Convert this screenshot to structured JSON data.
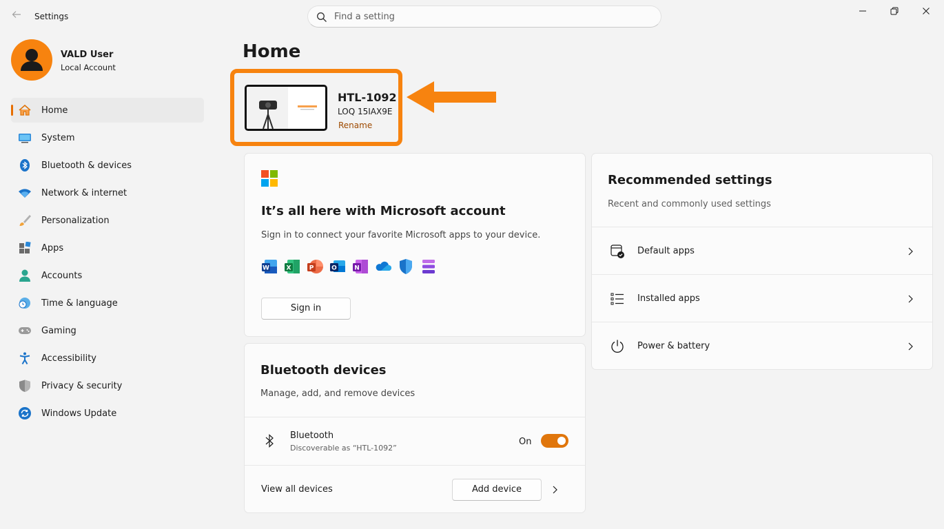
{
  "titlebar": {
    "back_icon": "back-arrow-icon",
    "app_title": "Settings",
    "search_placeholder": "Find a setting",
    "search_icon": "search-icon",
    "window_controls": [
      "minimize-icon",
      "restore-icon",
      "close-icon"
    ]
  },
  "profile": {
    "name": "VALD User",
    "account_type": "Local Account",
    "avatar_color": "#f7830f"
  },
  "sidebar": {
    "items": [
      {
        "label": "Home",
        "icon": "home-icon",
        "active": true
      },
      {
        "label": "System",
        "icon": "system-icon"
      },
      {
        "label": "Bluetooth & devices",
        "icon": "bluetooth-icon"
      },
      {
        "label": "Network & internet",
        "icon": "wifi-icon"
      },
      {
        "label": "Personalization",
        "icon": "brush-icon"
      },
      {
        "label": "Apps",
        "icon": "apps-icon"
      },
      {
        "label": "Accounts",
        "icon": "accounts-icon"
      },
      {
        "label": "Time & language",
        "icon": "time-language-icon"
      },
      {
        "label": "Gaming",
        "icon": "gamepad-icon"
      },
      {
        "label": "Accessibility",
        "icon": "accessibility-icon"
      },
      {
        "label": "Privacy & security",
        "icon": "shield-icon"
      },
      {
        "label": "Windows Update",
        "icon": "update-icon"
      }
    ]
  },
  "main": {
    "page_title": "Home",
    "device": {
      "name": "HTL-1092",
      "model": "LOQ 15IAX9E",
      "rename_label": "Rename",
      "highlight_color": "#f7830f"
    },
    "microsoft_card": {
      "title": "It’s all here with Microsoft account",
      "description": "Sign in to connect your favorite Microsoft apps to your device.",
      "apps": [
        "word-icon",
        "excel-icon",
        "powerpoint-icon",
        "outlook-icon",
        "onenote-icon",
        "onedrive-icon",
        "defender-icon",
        "clipchamp-icon"
      ],
      "signin_label": "Sign in"
    },
    "bluetooth_card": {
      "title": "Bluetooth devices",
      "description": "Manage, add, and remove devices",
      "bluetooth_label": "Bluetooth",
      "bluetooth_sub": "Discoverable as “HTL-1092”",
      "toggle_state": "On",
      "toggle_on": true,
      "view_all_label": "View all devices",
      "add_device_label": "Add device"
    },
    "recommended_card": {
      "title": "Recommended settings",
      "description": "Recent and commonly used settings",
      "rows": [
        {
          "label": "Default apps",
          "icon": "default-apps-icon"
        },
        {
          "label": "Installed apps",
          "icon": "installed-apps-icon"
        },
        {
          "label": "Power & battery",
          "icon": "power-icon"
        }
      ]
    }
  },
  "colors": {
    "accent": "#e0760c",
    "link": "#9e4a00",
    "background": "#f3f3f3",
    "card": "#fbfbfb"
  }
}
